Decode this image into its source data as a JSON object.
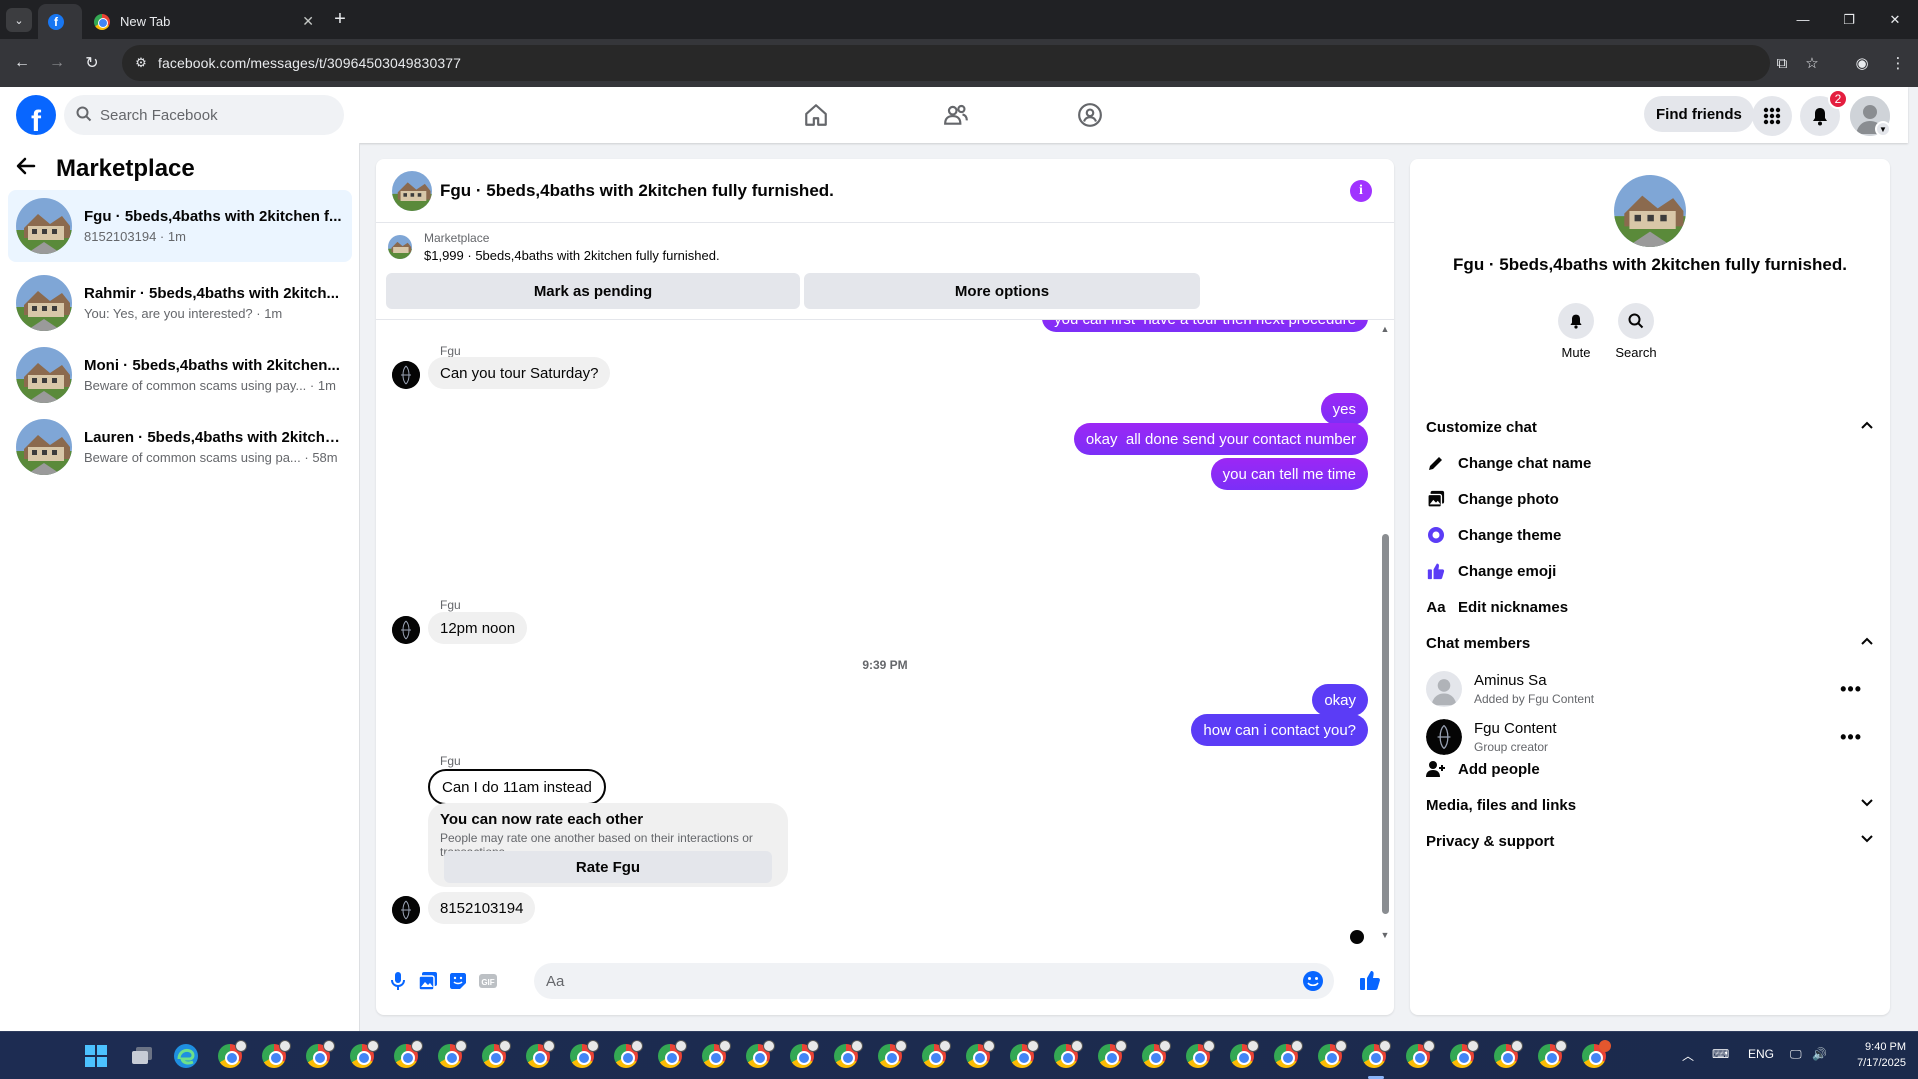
{
  "browser": {
    "tabs": [
      {
        "title": "",
        "favicon": "facebook-icon"
      },
      {
        "title": "New Tab",
        "favicon": "chrome-icon"
      }
    ],
    "url": "facebook.com/messages/t/30964503049830377"
  },
  "fb_nav": {
    "search_placeholder": "Search Facebook",
    "find_friends_label": "Find friends",
    "notification_count": "2",
    "nav_icons": [
      "home-icon",
      "friends-icon",
      "groups-icon"
    ]
  },
  "left_panel": {
    "title": "Marketplace",
    "conversations": [
      {
        "title": "Fgu · 5beds,4baths with 2kitchen f...",
        "subtitle": "8152103194 · 1m",
        "active": true
      },
      {
        "title": "Rahmir · 5beds,4baths with 2kitch...",
        "subtitle": "You: Yes, are you interested? · 1m",
        "active": false
      },
      {
        "title": "Moni · 5beds,4baths with 2kitchen...",
        "subtitle": "Beware of common scams using pay... · 1m",
        "active": false
      },
      {
        "title": "Lauren · 5beds,4baths with 2kitche...",
        "subtitle": "Beware of common scams using pa... · 58m",
        "active": false
      }
    ]
  },
  "chat": {
    "title": "Fgu · 5beds,4baths with 2kitchen fully furnished.",
    "marketplace_label": "Marketplace",
    "listing": "$1,999 · 5beds,4baths with 2kitchen fully furnished.",
    "mark_pending_label": "Mark as pending",
    "more_options_label": "More options",
    "partial_message": "you can first  have a tour then next procedure",
    "messages": {
      "sender1": "Fgu",
      "in1": "Can you tour Saturday?",
      "out1": "yes",
      "out2": "okay  all done send your contact number",
      "out3": "you can tell me time",
      "sender2": "Fgu",
      "in2": "12pm noon",
      "timestamp": "9:39 PM",
      "out4": "okay",
      "out5": "how can i contact you?",
      "sender3": "Fgu",
      "in3": "Can I do 11am instead",
      "rate_title": "You can now rate each other",
      "rate_sub": "People may rate one another based on their interactions or transactions.",
      "rate_button": "Rate Fgu",
      "in4": "8152103194"
    },
    "composer_placeholder": "Aa"
  },
  "right_panel": {
    "name": "Fgu · 5beds,4baths with 2kitchen fully furnished.",
    "mute_label": "Mute",
    "search_label": "Search",
    "customize_chat": "Customize chat",
    "change_chat_name": "Change chat name",
    "change_photo": "Change photo",
    "change_theme": "Change theme",
    "change_emoji": "Change emoji",
    "edit_nicknames": "Edit nicknames",
    "chat_members": "Chat members",
    "members": [
      {
        "name": "Aminus Sa",
        "sub": "Added by Fgu Content"
      },
      {
        "name": "Fgu Content",
        "sub": "Group creator"
      }
    ],
    "add_people": "Add people",
    "media_files_links": "Media, files and links",
    "privacy_support": "Privacy & support"
  },
  "taskbar": {
    "language": "ENG",
    "time": "9:40 PM",
    "date": "7/17/2025"
  },
  "colors": {
    "fb_blue": "#0866ff",
    "outgoing_purple": "#9c27f5",
    "outgoing_blue": "#5b3cf6",
    "badge_red": "#e41e3f",
    "theme_accent": "#a033ff"
  }
}
